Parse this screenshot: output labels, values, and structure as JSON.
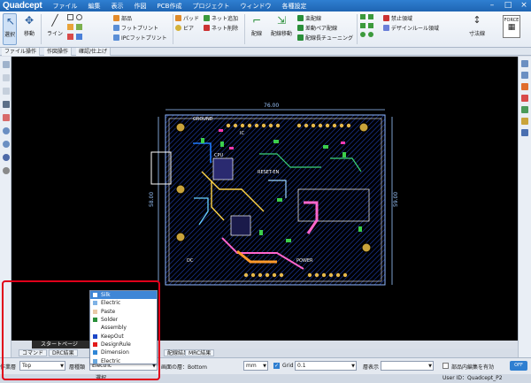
{
  "app": {
    "logo": "Quadcept"
  },
  "menu": [
    "ファイル",
    "編集",
    "表示",
    "作図",
    "PCB作成",
    "プロジェクト",
    "ウィンドウ",
    "各種設定"
  ],
  "ribbon": {
    "select": "選択",
    "move": "移動",
    "line": "ライン",
    "parts": "部品",
    "footprint": "フットプリント",
    "ipc_footprint": "IPCフットプリント",
    "pad": "パッド",
    "via": "ビア",
    "net_add": "ネット追加",
    "net_delete": "ネット削除",
    "wiring": "配線",
    "wiring_move": "配線移動",
    "bundle": "束配線",
    "diff_pair": "差動ペア配線",
    "length_tuning": "配線長チューニング",
    "keepout": "禁止領域",
    "design_rule_area": "デザインルール領域",
    "dimension": "寸法線",
    "force": "FORCE"
  },
  "ribbon_tabs": [
    "ファイル操作",
    "作図操作",
    "確認/仕上げ"
  ],
  "pcb": {
    "dim_top": "76.00",
    "dim_left": "58.00",
    "dim_right": "59.00",
    "labels": [
      "GROUND",
      "CPU",
      "RESET-EN",
      "POWER",
      "DC",
      "IC"
    ]
  },
  "bottom": {
    "start_tab": "スタートページ",
    "tabs": [
      "コマンド",
      "DRC結果",
      "配線結果",
      "MRC結果"
    ]
  },
  "status": {
    "work_layer_label": "作業層",
    "work_layer_value": "Top",
    "layer_type_label": "層種類",
    "layer_type_value": "Electric",
    "display_layer_text": "画面の層：Bottom",
    "unit_value": "mm",
    "grid_label": "Grid",
    "grid_value": "0.1",
    "layer_display_label": "層表示",
    "parts_edit_label": "部品内編集を有効",
    "edit_btn": "OFF",
    "user_id": "User ID：Quadcept_P2",
    "bottom_left": "選択"
  },
  "dropdown": {
    "items": [
      {
        "label": "Silk",
        "color": "#3f86d6",
        "selected": true
      },
      {
        "label": "Electric",
        "color": "#7fb2e5",
        "selected": false
      },
      {
        "label": "Paste",
        "color": "#e8c9a8",
        "selected": false
      },
      {
        "label": "Solder",
        "color": "#2a8f3a",
        "selected": false
      },
      {
        "label": "Assembly",
        "color": "#ffffff",
        "selected": false
      },
      {
        "label": "KeepOut",
        "color": "#1c47c7",
        "selected": false
      },
      {
        "label": "DesignRule",
        "color": "#e21a1a",
        "selected": false
      },
      {
        "label": "Dimension",
        "color": "#2f86d6",
        "selected": false
      },
      {
        "label": "Electric",
        "color": "#6aa8de",
        "selected": false
      }
    ]
  },
  "colors": {
    "accent": "#2f7fd1",
    "highlight": "#e0001a"
  }
}
